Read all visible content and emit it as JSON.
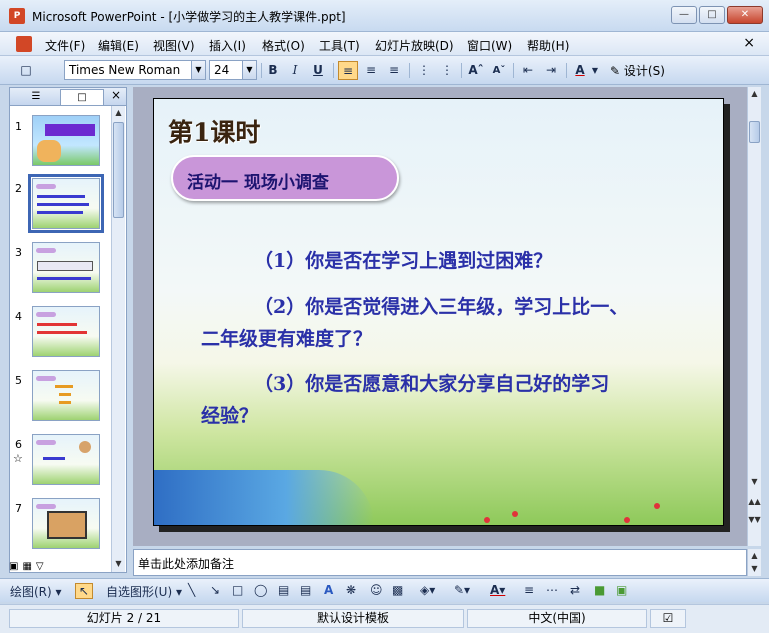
{
  "window": {
    "app_icon": "powerpoint-icon",
    "title": "Microsoft PowerPoint - [小学做学习的主人教学课件.ppt]",
    "buttons": [
      "minimize",
      "maximize",
      "close"
    ]
  },
  "menubar": {
    "items": [
      "文件(F)",
      "编辑(E)",
      "视图(V)",
      "插入(I)",
      "格式(O)",
      "工具(T)",
      "幻灯片放映(D)",
      "窗口(W)",
      "帮助(H)"
    ],
    "close": "×"
  },
  "toolbar": {
    "font_name": "Times New Roman",
    "font_size": "24",
    "bold": "B",
    "italic": "I",
    "underline": "U",
    "design_label": "设计(S)"
  },
  "slides_pane": {
    "tab_outline": "outline-tab-icon",
    "tab_slides": "slides-tab-icon",
    "close": "×",
    "numbers": [
      "1",
      "2",
      "3",
      "4",
      "5",
      "6",
      "7"
    ],
    "selected": "2",
    "star_label": "☆"
  },
  "slide": {
    "title": "第1课时",
    "activity": "活动一   现场小调查",
    "q1": "（1）你是否在学习上遇到过困难？",
    "q2_line1": "（2）你是否觉得进入三年级，学习上比一、",
    "q2_line2": "二年级更有难度了？",
    "q3_line1": "（3）你是否愿意和大家分享自己好的学习",
    "q3_line2": "经验？"
  },
  "notes": {
    "placeholder": "单击此处添加备注"
  },
  "drawbar": {
    "draw_label": "绘图(R)",
    "autoshapes_label": "自选图形(U)"
  },
  "statusbar": {
    "slide_info": "幻灯片 2 / 21",
    "template": "默认设计模板",
    "language": "中文(中国)"
  },
  "colors": {
    "activity_pill": "#c996d9",
    "question_text": "#2a30a8",
    "title_bar": "#c8daf0"
  }
}
